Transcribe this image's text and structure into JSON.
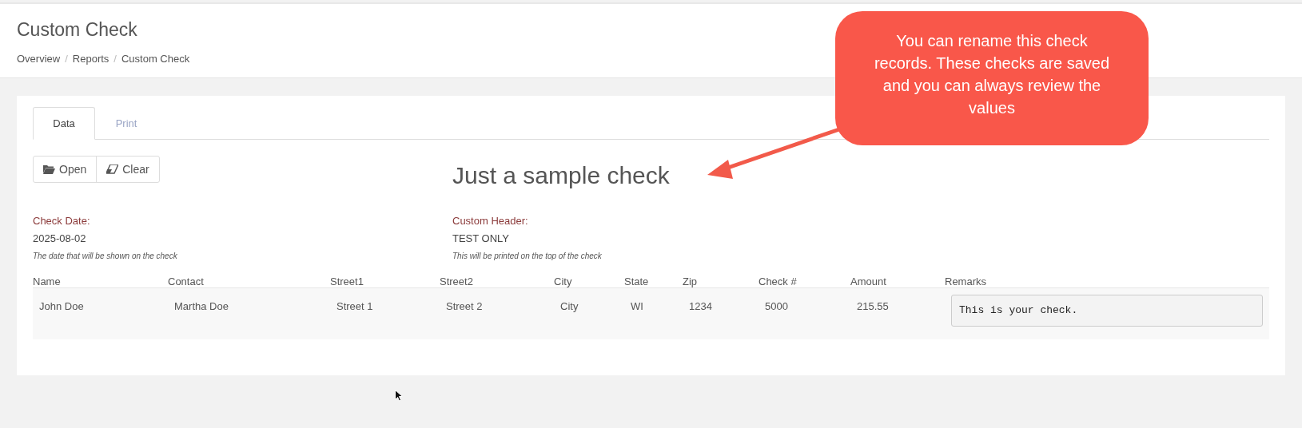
{
  "page": {
    "title": "Custom Check",
    "breadcrumb": [
      "Overview",
      "Reports",
      "Custom Check"
    ],
    "breadcrumb_separator": "/"
  },
  "tabs": [
    {
      "label": "Data",
      "selected": true
    },
    {
      "label": "Print",
      "selected": false
    }
  ],
  "toolbar": [
    {
      "label": "Open",
      "kind": "folder"
    },
    {
      "label": "Clear",
      "kind": "eraser"
    }
  ],
  "check_name": "Just a sample check",
  "fields": [
    {
      "label": "Check Date:",
      "value": "2025-08-02",
      "hint": "The date that will be shown on the check"
    },
    {
      "label": "Custom Header:",
      "value": "TEST ONLY",
      "hint": "This will be printed on the top of the check"
    }
  ],
  "table": {
    "columns": [
      "Name",
      "Contact",
      "Street1",
      "Street2",
      "City",
      "State",
      "Zip",
      "Check #",
      "Amount",
      "Remarks"
    ],
    "rows": [
      {
        "cells": [
          "John Doe",
          "Martha Doe",
          "Street 1",
          "Street 2",
          "City",
          "WI",
          "1234",
          "5000",
          "215.55"
        ],
        "remarks": "This is your check."
      }
    ]
  },
  "callout": {
    "text": "You can rename this check records. These checks are saved and you can always review the values"
  }
}
